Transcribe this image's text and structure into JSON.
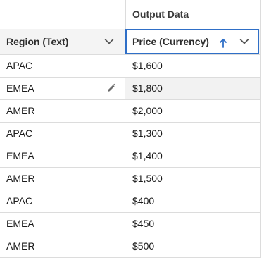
{
  "group_header": {
    "label": "Output Data"
  },
  "columns": {
    "region": {
      "label": "Region (Text)",
      "menu_icon": "chevron-down-icon"
    },
    "price": {
      "label": "Price (Currency)",
      "sort_icon": "arrow-up-icon",
      "sort": "ascending",
      "menu_icon": "chevron-down-icon",
      "selected": true
    }
  },
  "rows": [
    {
      "region": "APAC",
      "price": "$1,600"
    },
    {
      "region": "EMEA",
      "price": "$1,800",
      "hovered": true,
      "edit_icon": "pencil-icon"
    },
    {
      "region": "AMER",
      "price": "$2,000"
    },
    {
      "region": "APAC",
      "price": "$1,300"
    },
    {
      "region": "EMEA",
      "price": "$1,400"
    },
    {
      "region": "AMER",
      "price": "$1,500"
    },
    {
      "region": "APAC",
      "price": "$400"
    },
    {
      "region": "EMEA",
      "price": "$450"
    },
    {
      "region": "AMER",
      "price": "$500"
    }
  ],
  "colors": {
    "accent": "#2f6fc7",
    "header_bg": "#f4f4f4",
    "border": "#dcdcdc",
    "hover_bg": "#f2f2f2"
  }
}
